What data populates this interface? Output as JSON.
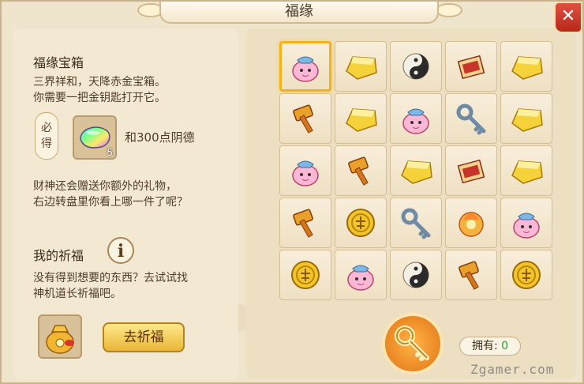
{
  "window": {
    "title": "福缘",
    "close_label": "✕"
  },
  "left": {
    "box_title": "福缘宝箱",
    "desc_line1": "三界祥和，天降赤金宝箱。",
    "desc_line2": "你需要一把金钥匙打开它。",
    "must_get_char1": "必",
    "must_get_char2": "得",
    "reward_item_count": "5",
    "reward_extra": "和300点阴德",
    "bonus_line1": "财神还会赠送你额外的礼物，",
    "bonus_line2": "右边转盘里你看上哪一件了呢？",
    "blessing_title": "我的祈福",
    "info_label": "i",
    "blessing_line1": "没有得到想要的东西？去试试找",
    "blessing_line2": "神机道长祈福吧。",
    "pray_button": "去祈福"
  },
  "grid": {
    "selected_index": 0,
    "rows": [
      [
        "bag-icon",
        "gold-bar-icon",
        "yin-yang-icon",
        "scroll-icon",
        "gold-bar-icon"
      ],
      [
        "hammer-icon",
        "gold-bar-icon",
        "bag-icon",
        "key-icon",
        "gold-bar-icon"
      ],
      [
        "bag-icon",
        "hammer-icon",
        "gold-bar-icon",
        "scroll-icon",
        "gold-bar-icon"
      ],
      [
        "hammer-icon",
        "coin-icon",
        "key-icon",
        "fire-orb-icon",
        "bag-icon"
      ],
      [
        "coin-icon",
        "bag-icon",
        "yin-yang-icon",
        "hammer-icon",
        "coin-icon"
      ]
    ]
  },
  "footer": {
    "own_label": "拥有:",
    "own_value": "0",
    "watermark": "Zgamer.com"
  },
  "colors": {
    "accent": "#f2b31a",
    "close": "#c9382a",
    "own_value": "#2e9a3a"
  }
}
